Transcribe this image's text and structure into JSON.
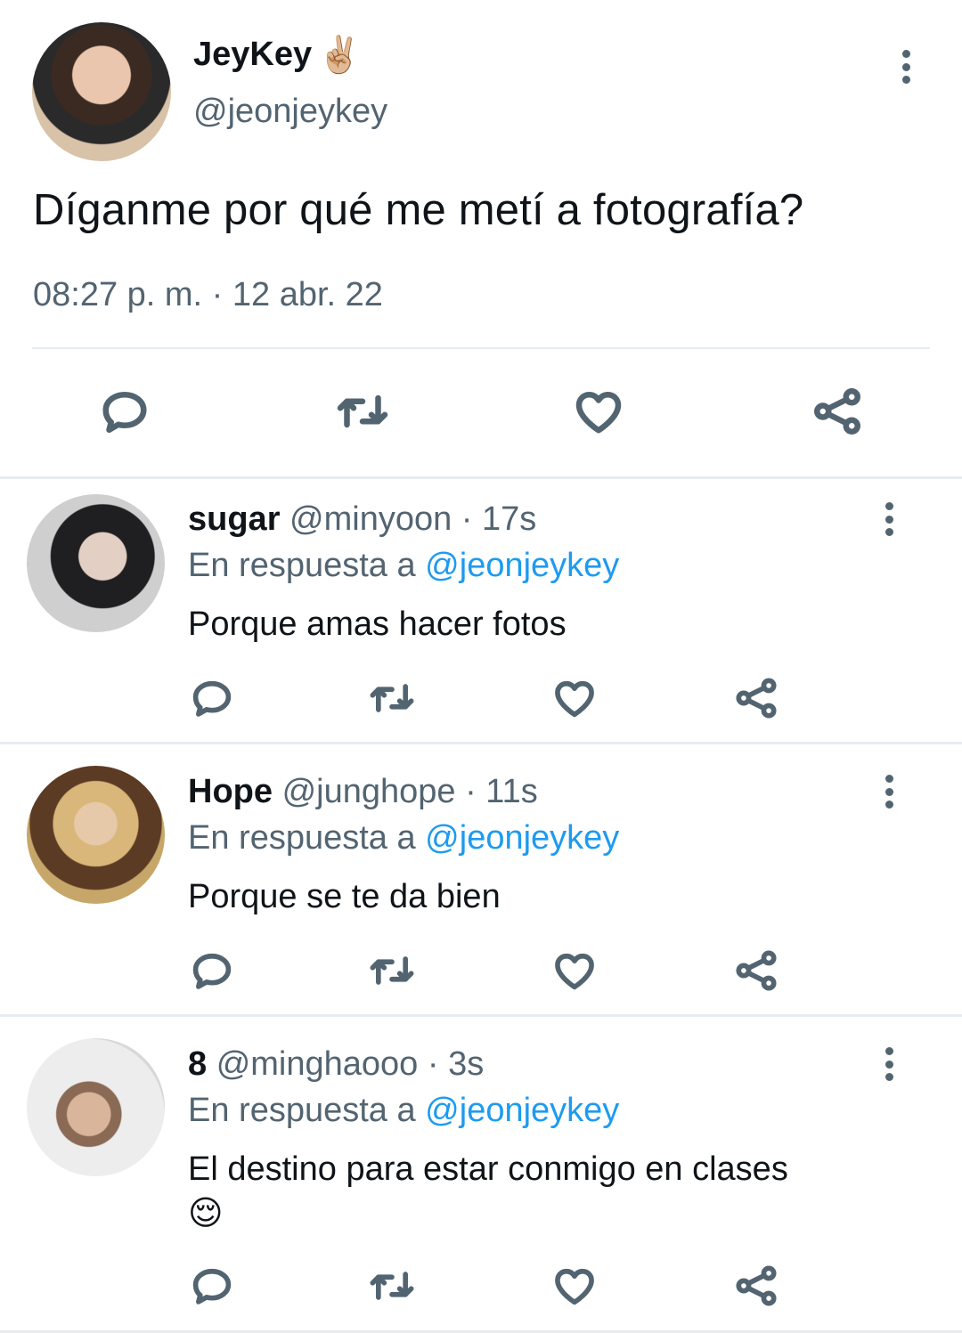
{
  "main_tweet": {
    "display_name": "JeyKey",
    "name_emoji": "✌🏼",
    "handle": "@jeonjeykey",
    "text": "Díganme por qué me metí a fotografía?",
    "timestamp": "08:27 p. m. · 12 abr. 22"
  },
  "replies": [
    {
      "display_name": "sugar",
      "meta": "@minyoon · 17s",
      "reply_prefix": "En respuesta a ",
      "reply_mention": "@jeonjeykey",
      "text": "Porque amas hacer fotos"
    },
    {
      "display_name": "Hope",
      "meta": "@junghope · 11s",
      "reply_prefix": "En respuesta a ",
      "reply_mention": "@jeonjeykey",
      "text": "Porque se te da bien"
    },
    {
      "display_name": "8",
      "meta": "@minghaooo · 3s",
      "reply_prefix": "En respuesta a ",
      "reply_mention": "@jeonjeykey",
      "text": "El destino para estar conmigo en clases",
      "text_emoji": "😌"
    }
  ],
  "icons": {
    "reply": "reply-icon",
    "retweet": "retweet-icon",
    "like": "heart-icon",
    "share": "share-icon",
    "more": "more-vertical-icon"
  },
  "colors": {
    "text": "#0f1419",
    "secondary": "#536471",
    "mention": "#1d9bf0",
    "divider": "#e6ecf0"
  }
}
